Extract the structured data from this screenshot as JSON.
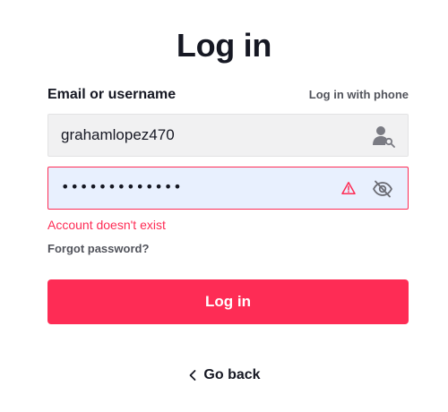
{
  "header": {
    "title": "Log in"
  },
  "form": {
    "field_label": "Email or username",
    "alt_login_link": "Log in with phone",
    "username_value": "grahamlopez470",
    "password_masked": "•••••••••••••",
    "error_message": "Account doesn't exist",
    "forgot_password": "Forgot password?",
    "submit_label": "Log in"
  },
  "footer": {
    "back_label": "Go back"
  },
  "icons": {
    "username_field": "user-key-icon",
    "password_warning": "warning-icon",
    "password_visibility": "eye-off-icon",
    "back": "chevron-left-icon"
  },
  "colors": {
    "accent": "#fe2c55",
    "text": "#161823",
    "username_field_bg": "#f1f1f2",
    "password_field_bg": "#e8f0fe"
  }
}
